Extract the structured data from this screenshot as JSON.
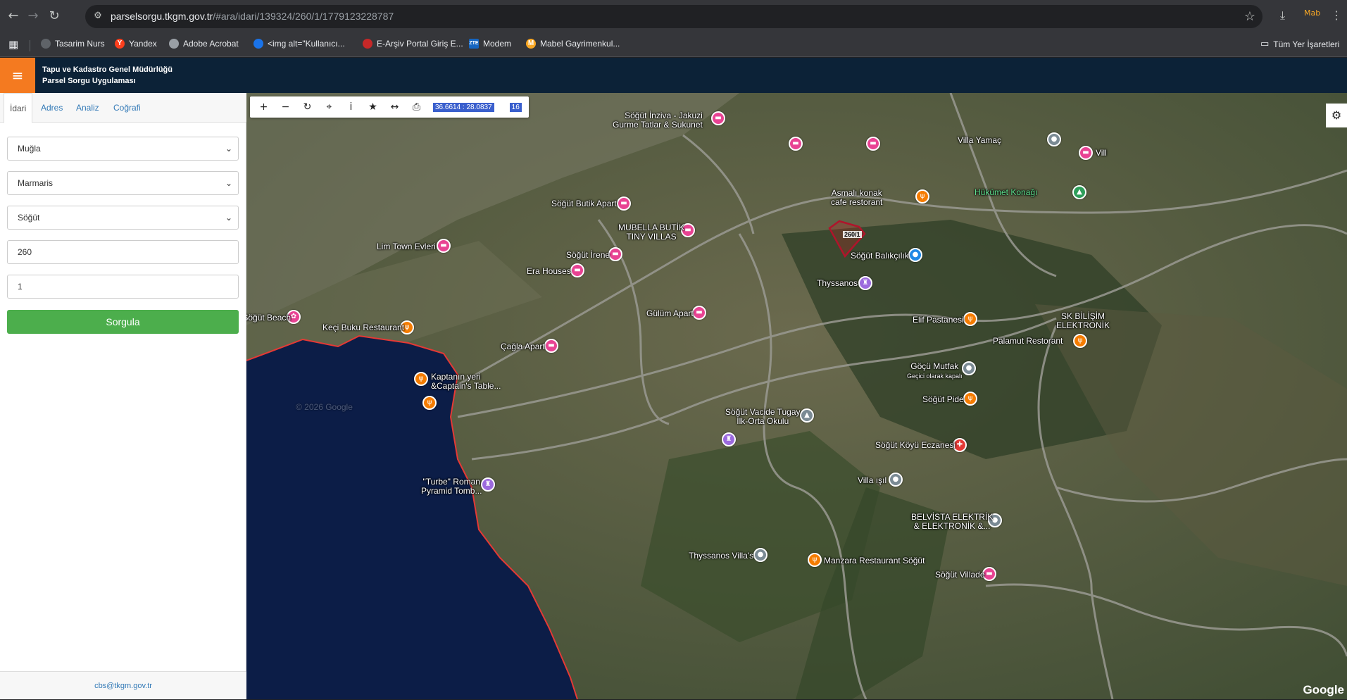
{
  "browser": {
    "url_host": "parselsorgu.tkgm.gov.tr",
    "url_path": "/#ara/idari/139324/260/1/1779123228787",
    "bookmarks": [
      {
        "label": "Tasarim Nurs",
        "color": "#5f6368"
      },
      {
        "label": "Yandex",
        "color": "#fc3f1d"
      },
      {
        "label": "Adobe Acrobat",
        "color": "#9aa0a6"
      },
      {
        "label": "<img alt=\"Kullanıcı...",
        "color": "#1a73e8"
      },
      {
        "label": "E-Arşiv Portal Giriş E...",
        "color": "#c62828"
      },
      {
        "label": "Modem",
        "color": "#1565c0"
      },
      {
        "label": "Mabel Gayrimenkul...",
        "color": "#f9a825"
      }
    ],
    "all_bookmarks": "Tüm Yer İşaretleri"
  },
  "app": {
    "title_line1": "Tapu ve Kadastro Genel Müdürlüğü",
    "title_line2": "Parsel Sorgu Uygulaması"
  },
  "sidebar": {
    "tabs": [
      "İdari",
      "Adres",
      "Analiz",
      "Coğrafi"
    ],
    "active_tab": "İdari",
    "province": "Muğla",
    "district": "Marmaris",
    "neighborhood": "Söğüt",
    "block": "260",
    "parcel": "1",
    "query_button": "Sorgula",
    "footer_email": "cbs@tkgm.gov.tr"
  },
  "map": {
    "coordinates": "36.6614 : 28.0837",
    "zoom": "16",
    "parcel_label": "260/1",
    "attribution": "Google",
    "copyright": "© 2026 Google",
    "places": [
      {
        "name": "Söğüt İnziva - Jakuzi",
        "name2": "Gurme Tatlar & Sukunet",
        "type": "pink"
      },
      {
        "name": "Villa Yamaç",
        "type": "grey"
      },
      {
        "name": "Vill",
        "type": "pink"
      },
      {
        "name": "Hükümet Konağı",
        "type": "green"
      },
      {
        "name": "Asmalı konak",
        "name2": "cafe restorant",
        "type": "orange"
      },
      {
        "name": "Söğüt Butik Apart",
        "type": "pink"
      },
      {
        "name": "MUBELLA BUTİK",
        "name2": "TINY VILLAS",
        "type": "pink"
      },
      {
        "name": "Lim Town Evleri",
        "type": "pink"
      },
      {
        "name": "Söğüt İrene",
        "type": "pink"
      },
      {
        "name": "Era Houses",
        "type": "pink"
      },
      {
        "name": "Söğüt Balıkçılık",
        "type": "blue"
      },
      {
        "name": "Thyssanos",
        "type": "purple"
      },
      {
        "name": "Gülüm Apart",
        "type": "pink"
      },
      {
        "name": "Elif Pastanesi",
        "type": "orange"
      },
      {
        "name": "SK BİLİŞİM",
        "name2": "ELEKTRONİK",
        "type": "none"
      },
      {
        "name": "Riva Söğüt Beach",
        "type": "pink"
      },
      {
        "name": "Keçi Buku Restaurant",
        "type": "orange"
      },
      {
        "name": "Palamut Restorant",
        "type": "orange"
      },
      {
        "name": "Çağla Apart",
        "type": "pink"
      },
      {
        "name": "Göçü Mutfak",
        "name2": "Geçici olarak kapalı",
        "type": "grey"
      },
      {
        "name": "Kaptanın yeri",
        "name2": "&Captain's Table...",
        "type": "orange"
      },
      {
        "name": "Söğüt Pide",
        "type": "orange"
      },
      {
        "name": "Söğüt Vacide Tugay",
        "name2": "İlk-Orta Okulu",
        "type": "grey"
      },
      {
        "name": "Söğüt Köyü Eczanesi",
        "type": "red"
      },
      {
        "name": "\"Turbe\" Roman",
        "name2": "Pyramid Tomb...",
        "type": "purple"
      },
      {
        "name": "Villa ışıl",
        "type": "grey"
      },
      {
        "name": "BELVİSTA ELEKTRİK",
        "name2": "& ELEKTRONİK &...",
        "type": "grey"
      },
      {
        "name": "Thyssanos Villa's",
        "type": "grey"
      },
      {
        "name": "Manzara Restaurant Söğüt",
        "type": "orange"
      },
      {
        "name": "Söğüt Villade",
        "type": "pink"
      }
    ]
  }
}
